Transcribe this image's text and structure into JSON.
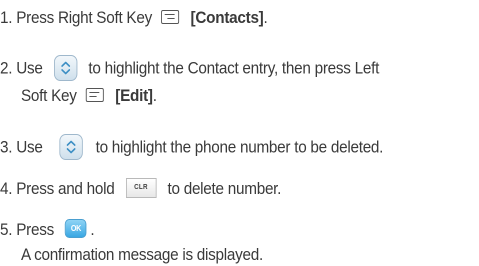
{
  "steps": [
    {
      "number": "1.",
      "before": "Press Right Soft Key",
      "key_icon": "right-soft-key-icon",
      "bold": "[Contacts]",
      "after": "."
    },
    {
      "number": "2.",
      "before": "Use",
      "key_icon": "navigation-key-icon",
      "after": "to highlight the Contact entry, then press Left",
      "cont_before": "Soft Key",
      "cont_key_icon": "left-soft-key-icon",
      "cont_bold": "[Edit]",
      "cont_after": "."
    },
    {
      "number": "3.",
      "before": "Use",
      "key_icon": "navigation-key-icon",
      "after": "to highlight the phone number to be deleted."
    },
    {
      "number": "4.",
      "before": "Press and hold",
      "key_icon": "clr-key-icon",
      "key_label": "CLR",
      "after": "to delete number."
    },
    {
      "number": "5.",
      "before": "Press",
      "key_icon": "ok-key-icon",
      "key_label": "OK",
      "after": ".",
      "cont_text": "A confirmation message is displayed."
    }
  ],
  "colors": {
    "text": "#3a3a3a",
    "ok_key": "#3aa7e3",
    "nav_key": "#cfe0ec"
  }
}
